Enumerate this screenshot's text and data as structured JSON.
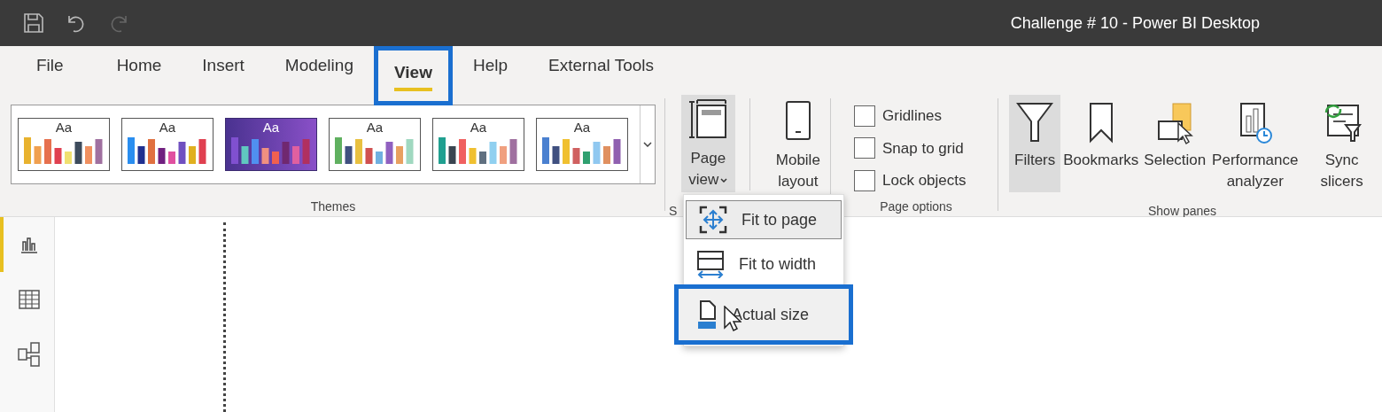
{
  "window": {
    "title": "Challenge # 10 - Power BI Desktop"
  },
  "tabs": [
    {
      "label": "File",
      "selected": false,
      "highlighted": false
    },
    {
      "label": "Home",
      "selected": false,
      "highlighted": false
    },
    {
      "label": "Insert",
      "selected": false,
      "highlighted": false
    },
    {
      "label": "Modeling",
      "selected": false,
      "highlighted": false
    },
    {
      "label": "View",
      "selected": true,
      "highlighted": true
    },
    {
      "label": "Help",
      "selected": false,
      "highlighted": false
    },
    {
      "label": "External Tools",
      "selected": false,
      "highlighted": false
    }
  ],
  "themes": {
    "label": "Themes",
    "items": [
      {
        "label": "Aa",
        "selected": false
      },
      {
        "label": "Aa",
        "selected": false
      },
      {
        "label": "Aa",
        "selected": true
      },
      {
        "label": "Aa",
        "selected": false
      },
      {
        "label": "Aa",
        "selected": false
      },
      {
        "label": "Aa",
        "selected": false
      }
    ]
  },
  "page_view_group": {
    "label": "S",
    "page_view": {
      "label": "Page view",
      "pressed": true
    },
    "mobile_layout": {
      "label": "Mobile layout"
    }
  },
  "page_options": {
    "label": "Page options",
    "items": [
      {
        "label": "Gridlines",
        "checked": false
      },
      {
        "label": "Snap to grid",
        "checked": false
      },
      {
        "label": "Lock objects",
        "checked": false
      }
    ]
  },
  "show_panes": {
    "label": "Show panes",
    "items": [
      {
        "kind": "filters",
        "label": "Filters",
        "pressed": true
      },
      {
        "kind": "bookmarks",
        "label": "Bookmarks",
        "pressed": false
      },
      {
        "kind": "selection",
        "label": "Selection",
        "pressed": false
      },
      {
        "kind": "performance",
        "label": "Performance analyzer",
        "pressed": false
      },
      {
        "kind": "sync",
        "label": "Sync slicers",
        "pressed": false
      }
    ]
  },
  "page_view_menu": [
    {
      "kind": "fit_page",
      "label": "Fit to page",
      "selected": true,
      "highlighted": false
    },
    {
      "kind": "fit_width",
      "label": "Fit to width",
      "selected": false,
      "highlighted": false
    },
    {
      "kind": "actual",
      "label": "Actual size",
      "selected": false,
      "highlighted": true
    }
  ],
  "left_nav": [
    {
      "kind": "report",
      "selected": true
    },
    {
      "kind": "data",
      "selected": false
    },
    {
      "kind": "model",
      "selected": false
    }
  ]
}
